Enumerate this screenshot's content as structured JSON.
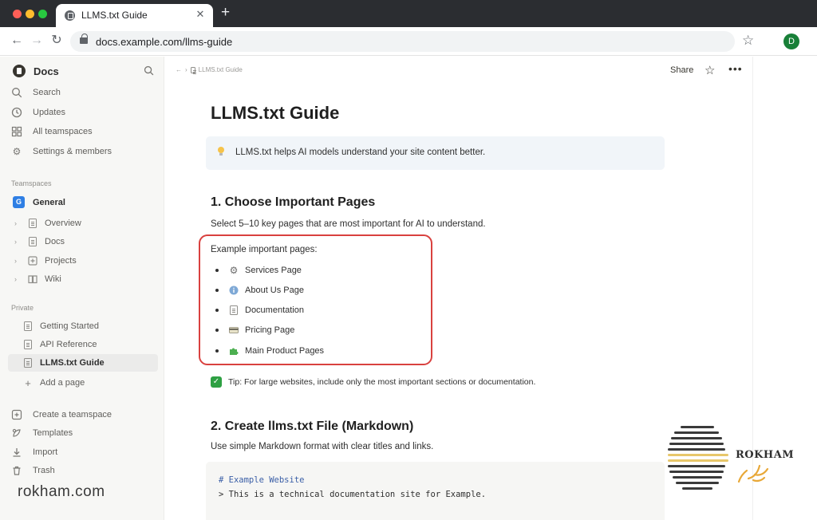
{
  "browser": {
    "tab_title": "LLMS.txt Guide",
    "tab_close": "✕",
    "new_tab": "+",
    "url": "docs.example.com/llms-guide",
    "profile_initial": "D"
  },
  "sidebar": {
    "workspace_name": "Docs",
    "top_items": [
      {
        "label": "Search",
        "icon": "search-icon"
      },
      {
        "label": "Updates",
        "icon": "clock-icon"
      },
      {
        "label": "All teamspaces",
        "icon": "grid-icon"
      },
      {
        "label": "Settings & members",
        "icon": "gear-icon"
      }
    ],
    "teamspaces_header": "Teamspaces",
    "teamspace": {
      "badge": "G",
      "label": "General"
    },
    "tree": [
      {
        "label": "Overview",
        "icon": "page-icon"
      },
      {
        "label": "Docs",
        "icon": "document-icon"
      },
      {
        "label": "Projects",
        "icon": "plus-box-icon"
      },
      {
        "label": "Wiki",
        "icon": "book-icon"
      }
    ],
    "private_header": "Private",
    "private_items": [
      {
        "label": "Getting Started"
      },
      {
        "label": "API Reference"
      },
      {
        "label": "LLMS.txt Guide",
        "active": true
      }
    ],
    "add_page": "Add a page",
    "bottom_items": [
      {
        "label": "Create a teamspace",
        "icon": "add-teamspace-icon"
      },
      {
        "label": "Templates",
        "icon": "templates-icon"
      },
      {
        "label": "Import",
        "icon": "import-icon"
      },
      {
        "label": "Trash",
        "icon": "trash-icon"
      }
    ],
    "watermark": "rokham.com"
  },
  "topbar": {
    "breadcrumb": "LLMS.txt Guide",
    "share": "Share"
  },
  "page": {
    "title": "LLMS.txt Guide",
    "callout": "LLMS.txt helps AI models understand your site content better.",
    "section1": {
      "heading": "1. Choose Important Pages",
      "text": "Select 5–10 key pages that are most important for AI to understand.",
      "list_intro": "Example important pages:",
      "items": [
        {
          "label": "Services Page",
          "icon": "gear-icon"
        },
        {
          "label": "About Us Page",
          "icon": "info-icon"
        },
        {
          "label": "Documentation",
          "icon": "document-icon"
        },
        {
          "label": "Pricing Page",
          "icon": "card-icon"
        },
        {
          "label": "Main Product Pages",
          "icon": "puzzle-icon"
        }
      ],
      "highlight_color": "#d9413f"
    },
    "tip": "Tip: For large websites, include only the most important sections or documentation.",
    "section2": {
      "heading": "2. Create llms.txt File (Markdown)",
      "text": "Use simple Markdown format with clear titles and links.",
      "code": [
        "# Example Website",
        "> This is a technical documentation site for Example."
      ]
    }
  },
  "logo": {
    "word": "ROKHAM"
  }
}
